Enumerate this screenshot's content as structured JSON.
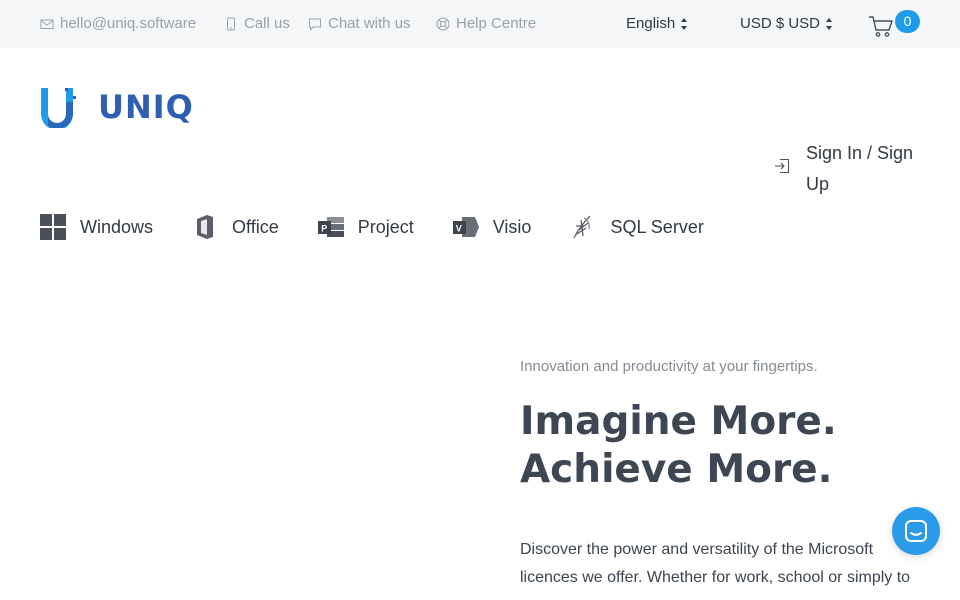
{
  "topbar": {
    "email": "hello@uniq.software",
    "call": "Call us",
    "chat": "Chat with us",
    "help": "Help Centre",
    "language": "English",
    "currency": "USD $ USD",
    "cart_count": "0"
  },
  "logo": {
    "text": "UNIQ"
  },
  "account": {
    "signin_label": "Sign In / Sign Up"
  },
  "nav": {
    "items": [
      {
        "label": "Windows",
        "icon": "windows-icon"
      },
      {
        "label": "Office",
        "icon": "office-icon"
      },
      {
        "label": "Project",
        "icon": "project-icon"
      },
      {
        "label": "Visio",
        "icon": "visio-icon"
      },
      {
        "label": "SQL Server",
        "icon": "sql-server-icon"
      }
    ]
  },
  "hero": {
    "tagline": "Innovation and productivity at your fingertips.",
    "headline_line1": "Imagine More.",
    "headline_line2": "Achieve More.",
    "body": "Discover the power and versatility of the Microsoft licences we offer. Whether for work, school or simply to"
  },
  "colors": {
    "accent": "#1e9cea",
    "brand": "#2f5fb0",
    "topbar_bg": "#f4f6f8",
    "chat_button": "#2b9ae8"
  }
}
